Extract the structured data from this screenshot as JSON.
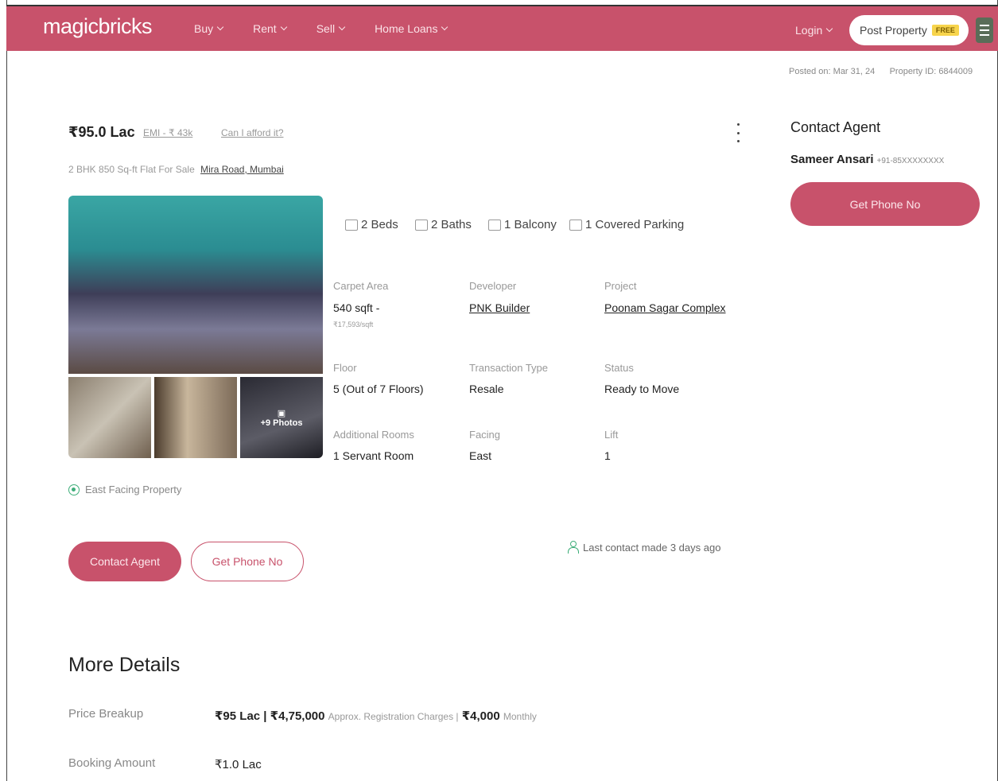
{
  "header": {
    "logo": "magicbricks",
    "nav": [
      "Buy",
      "Rent",
      "Sell",
      "Home Loans"
    ],
    "login": "Login",
    "post_property": "Post Property",
    "free_badge": "FREE"
  },
  "posted": {
    "text": "Posted on: Mar 31, 24",
    "property_id": "Property ID: 6844009"
  },
  "listing": {
    "price": "₹95.0 Lac",
    "emi": "EMI - ₹ 43k",
    "afford": "Can I afford it?",
    "subtitle_prefix": "2 BHK 850 Sq-ft Flat For Sale",
    "location": "Mira Road, Mumbai",
    "photos_more": "+9 Photos",
    "amenities": {
      "beds": "2 Beds",
      "baths": "2 Baths",
      "balcony": "1 Balcony",
      "parking": "1 Covered Parking"
    },
    "details": {
      "carpet_area_label": "Carpet Area",
      "carpet_area_value": "540 sqft -",
      "carpet_area_rate": "₹17,593/sqft",
      "developer_label": "Developer",
      "developer_value": "PNK Builder",
      "project_label": "Project",
      "project_value": "Poonam Sagar Complex",
      "floor_label": "Floor",
      "floor_value": "5 (Out of 7 Floors)",
      "transaction_label": "Transaction Type",
      "transaction_value": "Resale",
      "status_label": "Status",
      "status_value": "Ready to Move",
      "rooms_label": "Additional Rooms",
      "rooms_value": "1 Servant Room",
      "facing_label": "Facing",
      "facing_value": "East",
      "lift_label": "Lift",
      "lift_value": "1"
    },
    "east_facing": "East Facing Property",
    "contact_agent_btn": "Contact Agent",
    "get_phone_btn": "Get Phone No",
    "last_contact": "Last contact made 3 days ago"
  },
  "sidebar": {
    "title": "Contact Agent",
    "agent_name": "Sameer Ansari",
    "agent_phone": "+91-85XXXXXXXX",
    "get_phone_btn": "Get Phone No"
  },
  "more_details": {
    "title": "More Details",
    "price_breakup_label": "Price Breakup",
    "price_breakup_a": "₹95 Lac | ₹4,75,000",
    "price_breakup_b": "Approx. Registration Charges |",
    "price_breakup_c": "₹4,000",
    "price_breakup_d": "Monthly",
    "booking_label": "Booking Amount",
    "booking_value": "₹1.0 Lac"
  }
}
